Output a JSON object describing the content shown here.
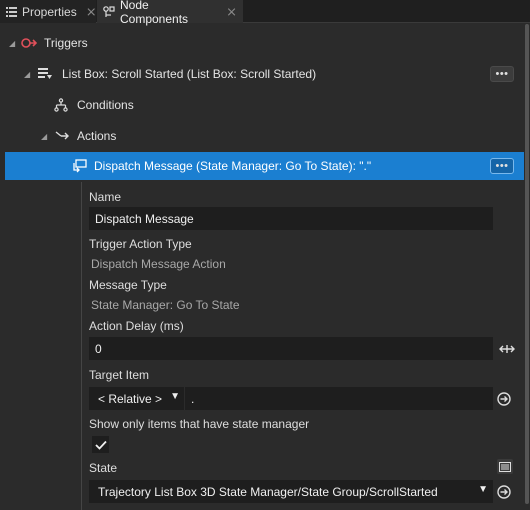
{
  "tabs": [
    {
      "label": "Properties",
      "icon": "list-icon"
    },
    {
      "label": "Node Components",
      "icon": "node-components-icon"
    }
  ],
  "tree": {
    "triggers": {
      "label": "Triggers",
      "icon": "trigger-icon"
    },
    "trigger_item": {
      "label": "List Box: Scroll Started (List Box: Scroll Started)",
      "icon": "event-list-icon",
      "more": "•••"
    },
    "conditions": {
      "label": "Conditions",
      "icon": "conditions-icon"
    },
    "actions": {
      "label": "Actions",
      "icon": "actions-icon"
    },
    "action_item": {
      "label": "Dispatch Message (State Manager: Go To State): \".\"",
      "icon": "dispatch-message-icon",
      "more": "•••"
    }
  },
  "properties": {
    "name": {
      "label": "Name",
      "value": "Dispatch Message"
    },
    "trigger_action_type": {
      "label": "Trigger Action Type",
      "value": "Dispatch Message Action"
    },
    "message_type": {
      "label": "Message Type",
      "value": "State Manager: Go To State"
    },
    "action_delay": {
      "label": "Action Delay (ms)",
      "value": "0"
    },
    "target_item": {
      "label": "Target Item",
      "selected": "< Relative >",
      "value": "."
    },
    "show_only": {
      "label": "Show only items that have state manager",
      "checked": true
    },
    "state": {
      "label": "State",
      "selected": "Trajectory List Box 3D State Manager/State Group/ScrollStarted"
    }
  },
  "colors": {
    "selection": "#1b7fd1",
    "background": "#2b2b2b",
    "field": "#1e1e1e",
    "trigger_red": "#e0505a"
  }
}
